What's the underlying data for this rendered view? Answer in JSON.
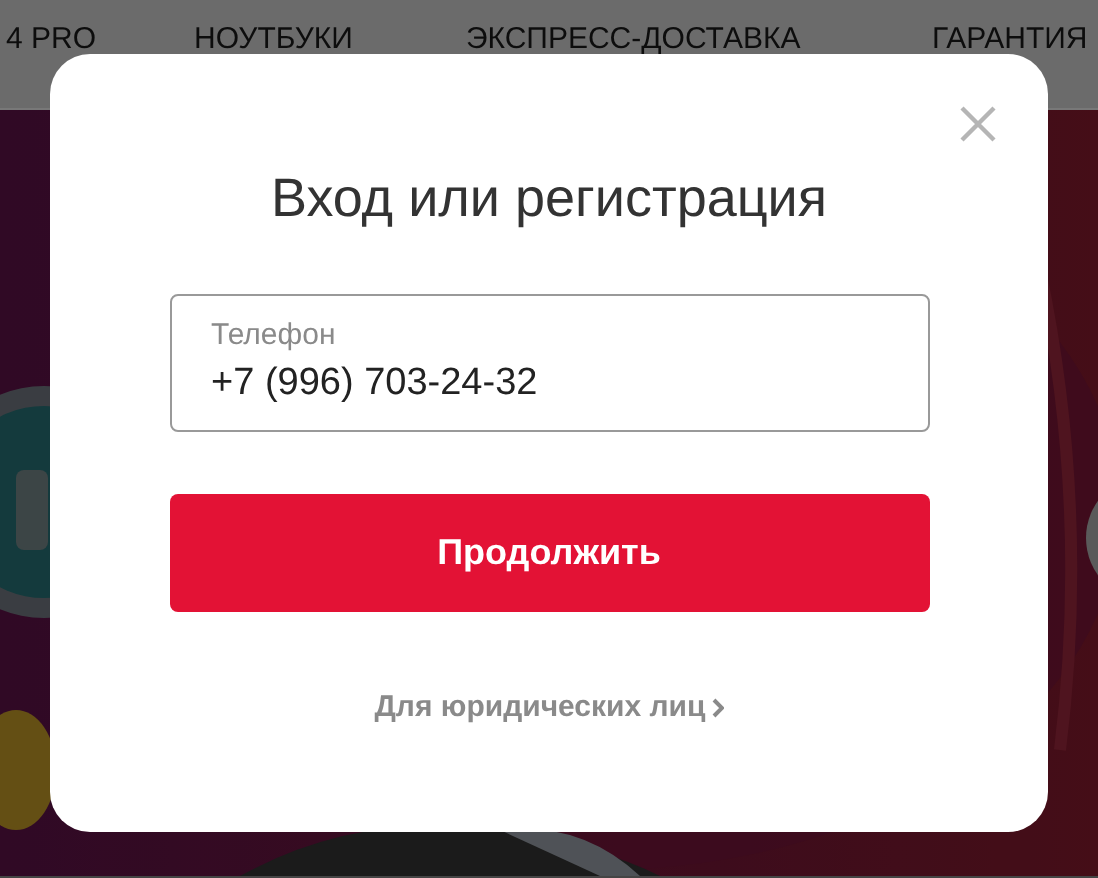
{
  "nav": {
    "items": [
      {
        "label": "4 PRO"
      },
      {
        "label": "НОУТБУКИ"
      },
      {
        "label": "ЭКСПРЕСС-ДОСТАВКА"
      },
      {
        "label": "ГАРАНТИЯ"
      }
    ]
  },
  "dialog": {
    "title": "Вход или регистрация",
    "phone_field": {
      "label": "Телефон",
      "value": "+7 (996) 703-24-32"
    },
    "continue_button": "Продолжить",
    "business_link": "Для юридических лиц"
  }
}
